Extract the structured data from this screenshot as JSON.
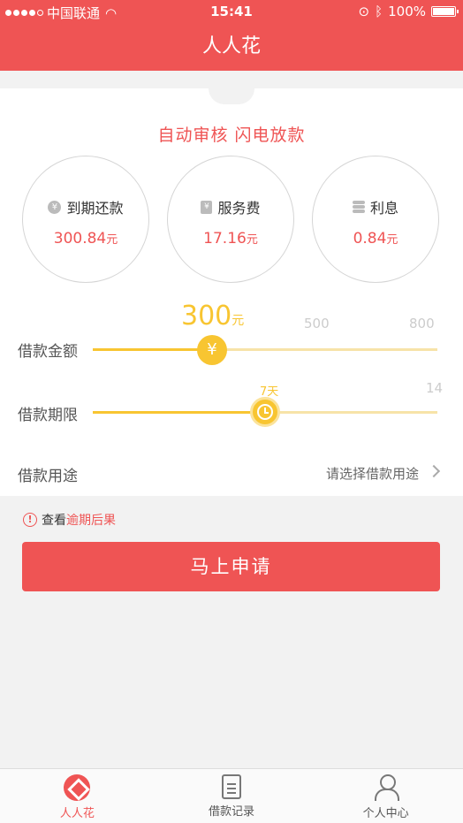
{
  "status_bar": {
    "carrier": "中国联通",
    "time": "15:41",
    "battery": "100%"
  },
  "nav": {
    "title": "人人花"
  },
  "slogan": "自动审核 闪电放款",
  "summary": [
    {
      "icon": "yen-coin-icon",
      "label": "到期还款",
      "value": "300.84",
      "unit": "元"
    },
    {
      "icon": "service-doc-icon",
      "label": "服务费",
      "value": "17.16",
      "unit": "元"
    },
    {
      "icon": "coin-stack-icon",
      "label": "利息",
      "value": "0.84",
      "unit": "元"
    }
  ],
  "loan_amount": {
    "label": "借款金额",
    "selected": "300",
    "unit": "元",
    "ticks": [
      "500",
      "800"
    ],
    "fill_fraction": 0.35
  },
  "loan_term": {
    "label": "借款期限",
    "selected": "7天",
    "max_tick": "14",
    "fill_fraction": 0.5
  },
  "loan_purpose": {
    "label": "借款用途",
    "placeholder": "请选择借款用途"
  },
  "warning": {
    "prefix": "查看",
    "link": "逾期后果"
  },
  "apply_button": "马上申请",
  "tabs": [
    {
      "label": "人人花",
      "active": true
    },
    {
      "label": "借款记录",
      "active": false
    },
    {
      "label": "个人中心",
      "active": false
    }
  ],
  "colors": {
    "brand": "#ef5454",
    "slider": "#f8c531"
  }
}
